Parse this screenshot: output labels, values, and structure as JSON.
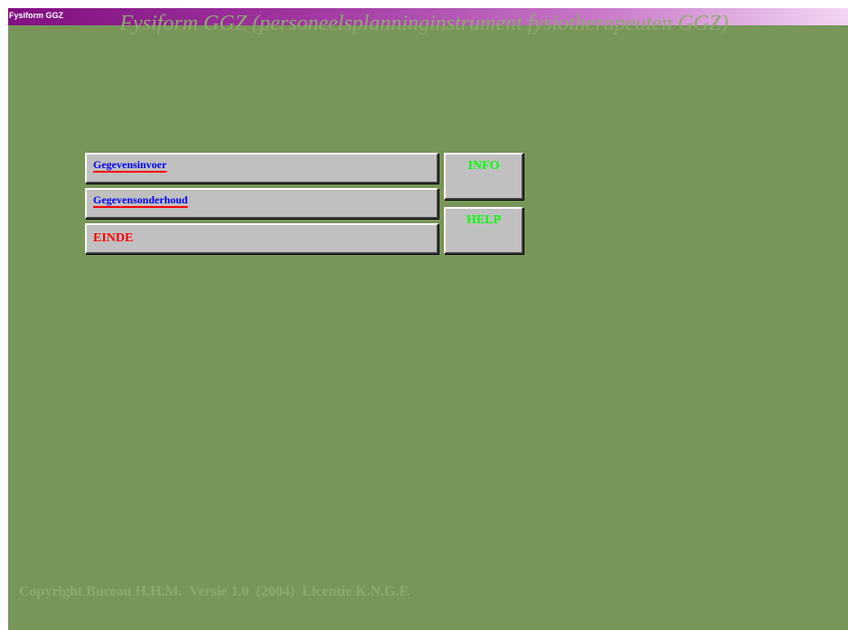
{
  "window": {
    "title": "Fysiform GGZ"
  },
  "heading": "Fysiform GGZ (personeelsplanninginstrument fysiotherapeuten GGZ)",
  "menu": {
    "data_entry_label": "Gegevensinvoer",
    "data_maintenance_label": "Gegevensonderhoud",
    "exit_label": "EINDE",
    "info_label": "INFO",
    "help_label": "HELP"
  },
  "footer": "Copyright Bureau H.H.M.  Versie 1.0  (2004)  Licentie K.N.G.F.",
  "colors": {
    "background": "#789658",
    "title_gradient_start": "#810f81",
    "link_text": "#0000ff",
    "link_underline": "#ff0000",
    "exit_text": "#ff0000",
    "side_button_text": "#00ff00",
    "faded_text": "#8caa6e"
  }
}
